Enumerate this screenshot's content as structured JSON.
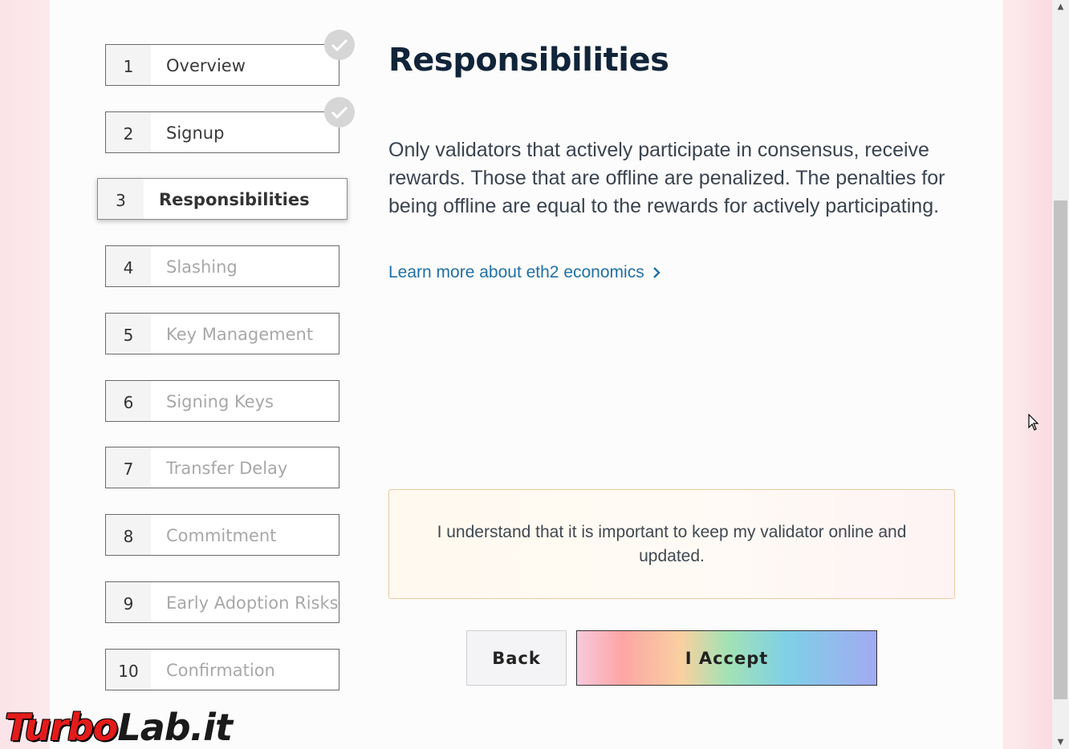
{
  "steps": [
    {
      "num": "1",
      "label": "Overview",
      "state": "done"
    },
    {
      "num": "2",
      "label": "Signup",
      "state": "done"
    },
    {
      "num": "3",
      "label": "Responsibilities",
      "state": "active"
    },
    {
      "num": "4",
      "label": "Slashing",
      "state": "pending"
    },
    {
      "num": "5",
      "label": "Key Management",
      "state": "pending"
    },
    {
      "num": "6",
      "label": "Signing Keys",
      "state": "pending"
    },
    {
      "num": "7",
      "label": "Transfer Delay",
      "state": "pending"
    },
    {
      "num": "8",
      "label": "Commitment",
      "state": "pending"
    },
    {
      "num": "9",
      "label": "Early Adoption Risks",
      "state": "pending"
    },
    {
      "num": "10",
      "label": "Confirmation",
      "state": "pending"
    }
  ],
  "main": {
    "title": "Responsibilities",
    "paragraph": "Only validators that actively participate in consensus, receive rewards. Those that are offline are penalized. The penalties for being offline are equal to the rewards for actively participating.",
    "learn_more": "Learn more about eth2 economics",
    "notice": "I understand that it is important to keep my validator online and updated.",
    "back_label": "Back",
    "accept_label": "I Accept"
  },
  "watermark": {
    "part1": "Turbo",
    "part2": "Lab.it"
  }
}
